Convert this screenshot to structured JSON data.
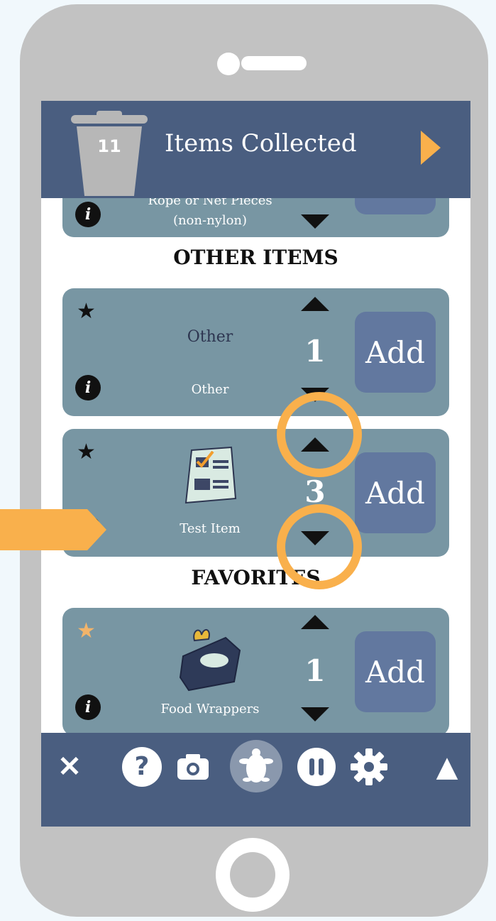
{
  "header": {
    "item_count": "11",
    "title": "Items Collected"
  },
  "cards": [
    {
      "label_line1": "Rope or Net Pieces",
      "label_line2": "(non-nylon)"
    },
    {
      "name": "Other",
      "label": "Other",
      "count": "1",
      "add_label": "Add"
    },
    {
      "label": "Test Item",
      "count": "3",
      "add_label": "Add"
    },
    {
      "label": "Food Wrappers",
      "count": "1",
      "add_label": "Add"
    }
  ],
  "sections": {
    "other_items": "OTHER ITEMS",
    "favorites": "FAVORITES"
  },
  "icons": {
    "star": "★",
    "info": "i",
    "close": "✕",
    "help": "?",
    "camera": "camera-icon",
    "turtle": "turtle-icon",
    "pause": "pause-icon",
    "settings": "gear-icon",
    "expand": "▲"
  },
  "colors": {
    "header": "#4a5e80",
    "card": "#7896a3",
    "add_button": "#62789f",
    "highlight": "#f9b04c",
    "favorite_star": "#f2b46a"
  }
}
